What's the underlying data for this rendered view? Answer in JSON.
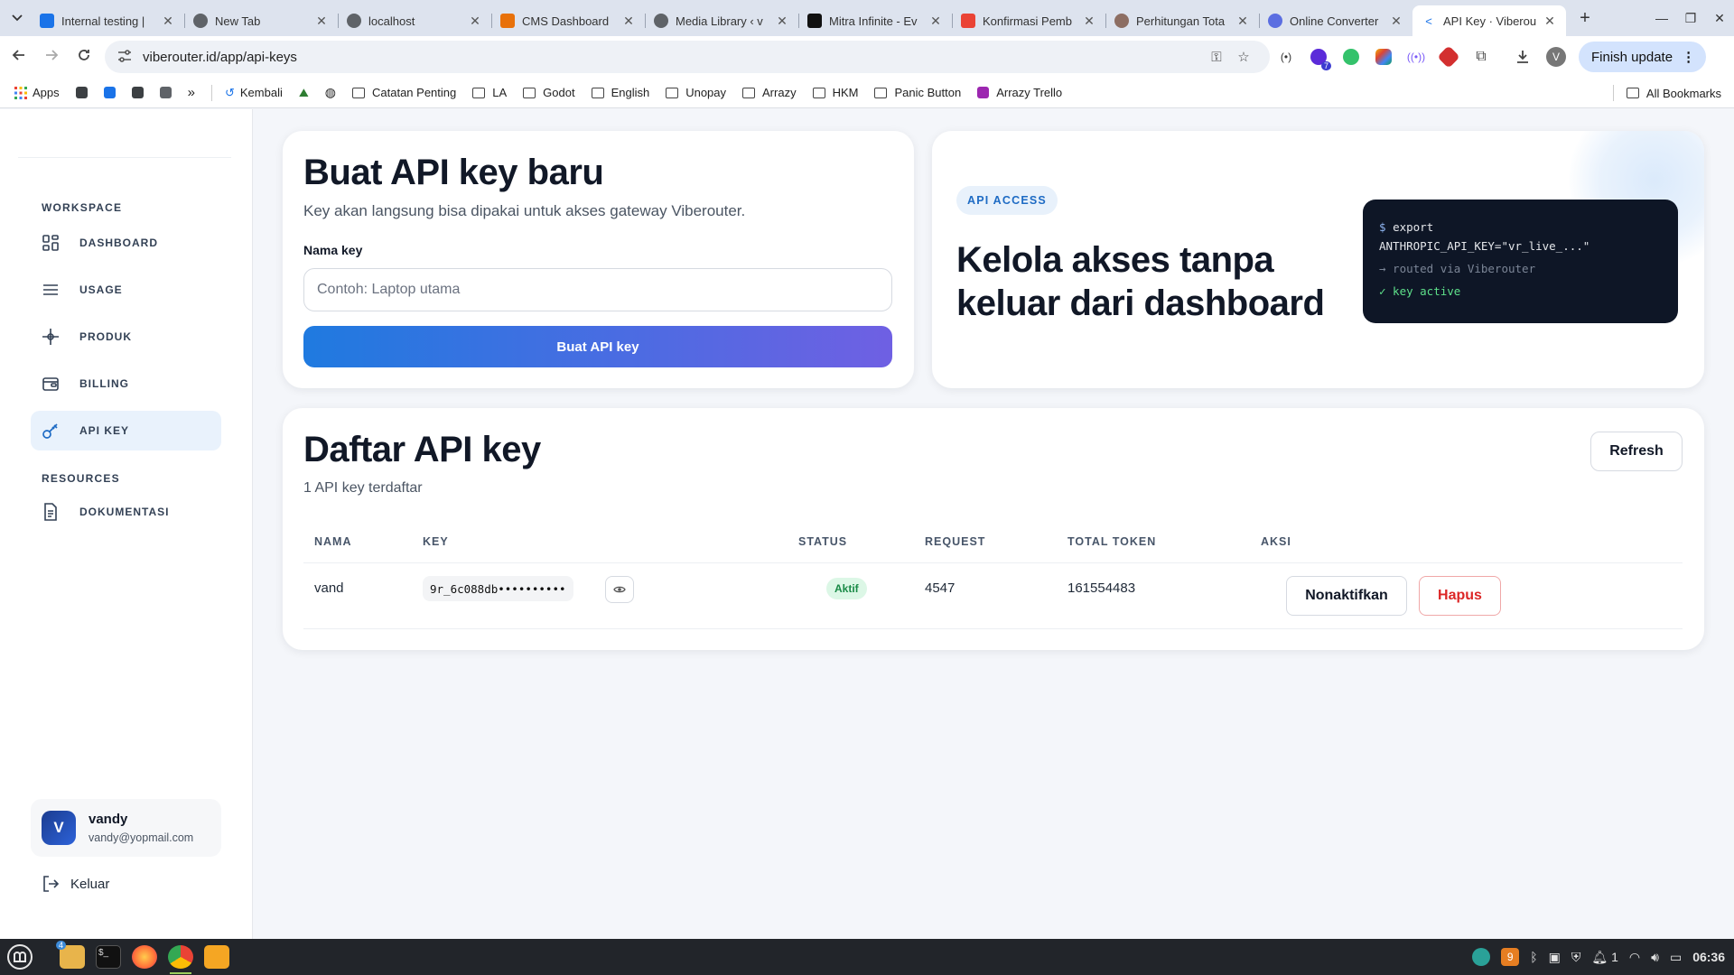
{
  "browser": {
    "tabs": [
      {
        "title": "Internal testing |",
        "favicon_color": "#1a73e8",
        "active": false
      },
      {
        "title": "New Tab",
        "favicon_color": "#5f6368",
        "active": false
      },
      {
        "title": "localhost",
        "favicon_color": "#5f6368",
        "active": false
      },
      {
        "title": "CMS Dashboard",
        "favicon_color": "#e8710a",
        "active": false
      },
      {
        "title": "Media Library ‹ v",
        "favicon_color": "#5f6368",
        "active": false
      },
      {
        "title": "Mitra Infinite - Ev",
        "favicon_color": "#111111",
        "active": false
      },
      {
        "title": "Konfirmasi Pemb",
        "favicon_color": "#ea4335",
        "active": false
      },
      {
        "title": "Perhitungan Tota",
        "favicon_color": "#8d6e63",
        "active": false
      },
      {
        "title": "Online Converter",
        "favicon_color": "#5b6ee1",
        "active": false
      },
      {
        "title": "API Key · Viberou",
        "favicon_color": "#1a73e8",
        "active": true
      }
    ],
    "url": "viberouter.id/app/api-keys",
    "finish_update_label": "Finish update",
    "profile_initial": "V",
    "extension_badge": "7",
    "bookmarks": [
      {
        "label": "Apps",
        "type": "apps"
      },
      {
        "label": "Kembali",
        "type": "link"
      },
      {
        "label": "Catatan Penting",
        "type": "folder"
      },
      {
        "label": "LA",
        "type": "folder"
      },
      {
        "label": "Godot",
        "type": "folder"
      },
      {
        "label": "English",
        "type": "folder"
      },
      {
        "label": "Unopay",
        "type": "folder"
      },
      {
        "label": "Arrazy",
        "type": "folder"
      },
      {
        "label": "HKM",
        "type": "folder"
      },
      {
        "label": "Panic Button",
        "type": "folder"
      },
      {
        "label": "Arrazy Trello",
        "type": "link"
      }
    ],
    "all_bookmarks_label": "All Bookmarks"
  },
  "sidebar": {
    "section_workspace": "WORKSPACE",
    "section_resources": "RESOURCES",
    "items": [
      {
        "label": "DASHBOARD",
        "icon": "grid-icon",
        "active": false
      },
      {
        "label": "USAGE",
        "icon": "list-icon",
        "active": false
      },
      {
        "label": "PRODUK",
        "icon": "sparkle-icon",
        "active": false
      },
      {
        "label": "BILLING",
        "icon": "wallet-icon",
        "active": false
      },
      {
        "label": "API KEY",
        "icon": "key-icon",
        "active": true
      }
    ],
    "resources": [
      {
        "label": "DOKUMENTASI",
        "icon": "document-icon"
      }
    ],
    "user": {
      "initial": "V",
      "name": "vandy",
      "email": "vandy@yopmail.com"
    },
    "logout_label": "Keluar"
  },
  "create": {
    "title": "Buat API key baru",
    "subtitle": "Key akan langsung bisa dipakai untuk akses gateway Viberouter.",
    "field_label": "Nama key",
    "placeholder": "Contoh: Laptop utama",
    "value": "",
    "button_label": "Buat API key"
  },
  "hero": {
    "pill": "API ACCESS",
    "title": "Kelola akses tanpa keluar dari dashboard",
    "terminal": {
      "prompt": "$",
      "line1": "export",
      "line2": "ANTHROPIC_API_KEY=\"vr_live_...\"",
      "line3": "→ routed via Viberouter",
      "line4": "✓ key active"
    }
  },
  "list": {
    "title": "Daftar API key",
    "subtitle": "1 API key terdaftar",
    "refresh_label": "Refresh",
    "columns": [
      "NAMA",
      "KEY",
      "STATUS",
      "REQUEST",
      "TOTAL TOKEN",
      "AKSI"
    ],
    "rows": [
      {
        "name": "vand",
        "key": "9r_6c088db••••••••••",
        "status": "Aktif",
        "requests": "4547",
        "total_tokens": "161554483",
        "deactivate_label": "Nonaktifkan",
        "delete_label": "Hapus"
      }
    ]
  },
  "taskbar": {
    "folder_badge": "4",
    "tray_badge": "9",
    "notif_count": "1",
    "time": "06:36"
  },
  "colors": {
    "accent_blue": "#1f7ae0",
    "accent_purple": "#6f60e3",
    "active_nav_bg": "#e9f2fc",
    "status_green": "#198a46",
    "danger_red": "#dc2626"
  }
}
